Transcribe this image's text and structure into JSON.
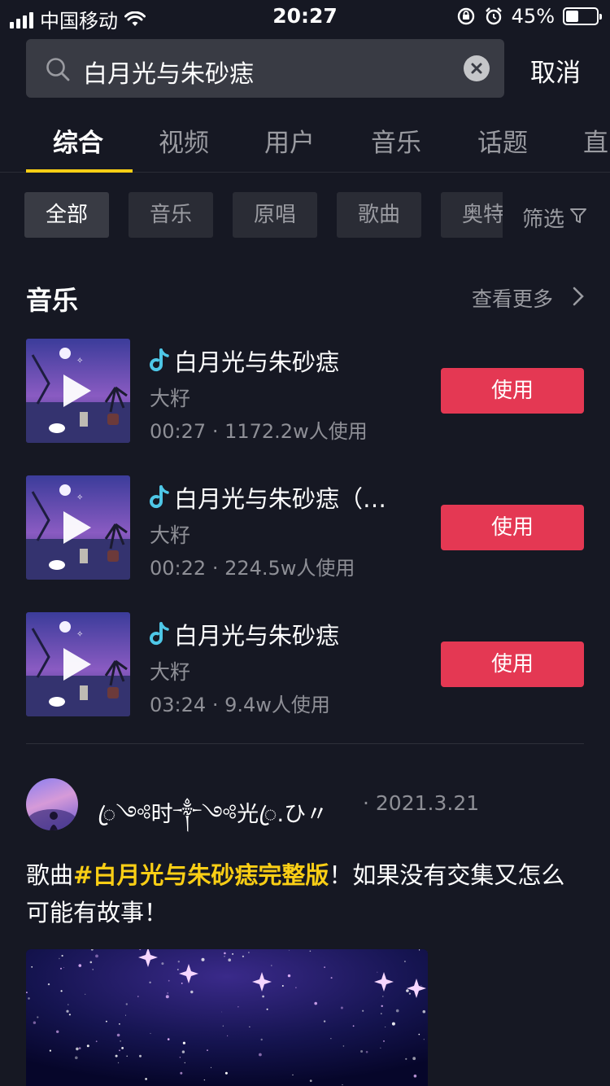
{
  "status_bar": {
    "carrier": "中国移动",
    "time": "20:27",
    "battery": "45%",
    "battery_level": 0.45
  },
  "search": {
    "query": "白月光与朱砂痣",
    "cancel_label": "取消"
  },
  "tabs": [
    {
      "label": "综合",
      "active": true
    },
    {
      "label": "视频"
    },
    {
      "label": "用户"
    },
    {
      "label": "音乐"
    },
    {
      "label": "话题"
    },
    {
      "label": "直"
    }
  ],
  "chips": [
    {
      "label": "全部",
      "active": true
    },
    {
      "label": "音乐"
    },
    {
      "label": "原唱"
    },
    {
      "label": "歌曲"
    },
    {
      "label": "奥特"
    }
  ],
  "filter_label": "筛选",
  "music_section": {
    "title": "音乐",
    "more_label": "查看更多",
    "tracks": [
      {
        "title": "白月光与朱砂痣",
        "artist": "大籽",
        "duration": "00:27",
        "uses": "1172.2w人使用",
        "button": "使用"
      },
      {
        "title": "白月光与朱砂痣（…",
        "artist": "大籽",
        "duration": "00:22",
        "uses": "224.5w人使用",
        "button": "使用"
      },
      {
        "title": "白月光与朱砂痣",
        "artist": "大籽",
        "duration": "03:24",
        "uses": "9.4w人使用",
        "button": "使用"
      }
    ],
    "meta_separator": "·"
  },
  "post": {
    "username": "ꦿ༺时༒༺光ꦿ.ひ〃",
    "date": "2021.3.21",
    "text_prefix": "歌曲",
    "hashtag": "#白月光与朱砂痣完整版",
    "text_suffix": "！如果没有交集又怎么可能有故事！"
  },
  "colors": {
    "background": "#161823",
    "accent_yellow": "#face15",
    "use_button": "#e43853",
    "muted_text": "#8e8f96"
  }
}
